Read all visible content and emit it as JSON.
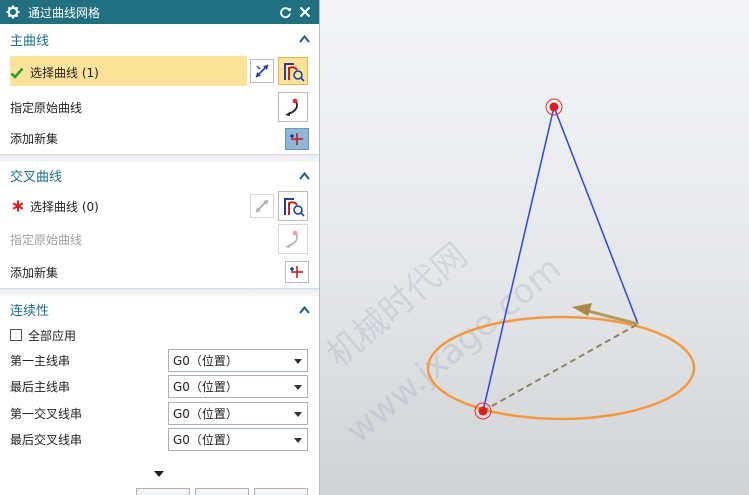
{
  "dialog": {
    "title": "通过曲线网格",
    "primary_curves": {
      "heading": "主曲线",
      "select_curve": {
        "label": "选择曲线 (1)",
        "status": "complete"
      },
      "specify_origin": {
        "label": "指定原始曲线"
      },
      "add_new_set": {
        "label": "添加新集"
      }
    },
    "cross_curves": {
      "heading": "交叉曲线",
      "select_curve": {
        "label": "选择曲线 (0)",
        "status": "required"
      },
      "specify_origin": {
        "label": "指定原始曲线",
        "enabled": false
      },
      "add_new_set": {
        "label": "添加新集"
      }
    },
    "continuity": {
      "heading": "连续性",
      "apply_all": {
        "label": "全部应用",
        "checked": false
      },
      "rows": [
        {
          "label": "第一主线串",
          "value": "G0（位置）"
        },
        {
          "label": "最后主线串",
          "value": "G0（位置）"
        },
        {
          "label": "第一交叉线串",
          "value": "G0（位置）"
        },
        {
          "label": "最后交叉线串",
          "value": "G0（位置）"
        }
      ]
    }
  },
  "watermark": {
    "line1": "机械时代网",
    "line2": "www.jxage.com"
  },
  "colors": {
    "title_bar": "#20707f",
    "section_heading": "#1d6f86",
    "selection_highlight": "#fbe39a",
    "check_green": "#2aa12a",
    "required_red": "#e01b1b",
    "curve_blue": "#2f45e8",
    "circle_orange": "#f59a3c",
    "vector_gold": "#b59a5a"
  }
}
